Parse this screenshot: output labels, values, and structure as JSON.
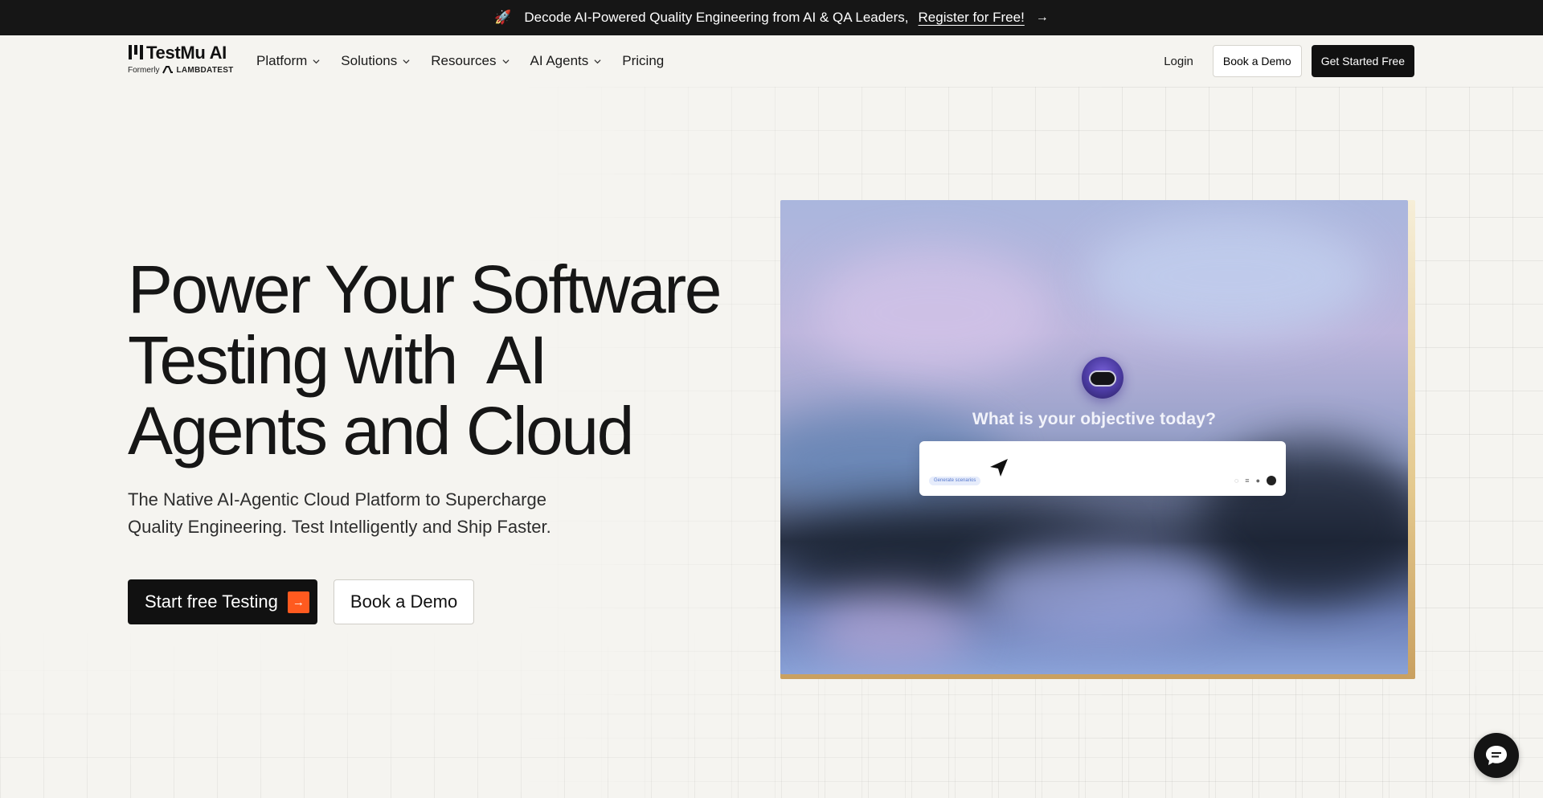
{
  "announcement": {
    "emoji": "🚀",
    "text": "Decode AI-Powered Quality Engineering from AI & QA Leaders,",
    "link_label": "Register for Free!",
    "arrow": "→"
  },
  "nav": {
    "brand": "TestMu AI",
    "formerly_label": "Formerly",
    "formerly_brand": "LAMBDATEST",
    "menu": [
      {
        "label": "Platform"
      },
      {
        "label": "Solutions"
      },
      {
        "label": "Resources"
      },
      {
        "label": "AI Agents"
      },
      {
        "label": "Pricing"
      }
    ],
    "login": "Login",
    "book_demo": "Book a Demo",
    "get_started": "Get Started Free"
  },
  "hero": {
    "title_lines": [
      "Power Your Software",
      "Testing with  AI",
      "Agents and Cloud"
    ],
    "subtitle": "The Native AI-Agentic Cloud Platform to Supercharge Quality Engineering. Test Intelligently and Ship Faster.",
    "cta_primary": "Start free Testing",
    "cta_primary_icon": "→",
    "cta_secondary": "Book a Demo"
  },
  "video": {
    "prompt_heading": "What is your objective today?",
    "chip_label": "Generate scenarios"
  },
  "colors": {
    "accent": "#ff5a1f",
    "dark": "#111111",
    "background": "#f5f4f0"
  }
}
